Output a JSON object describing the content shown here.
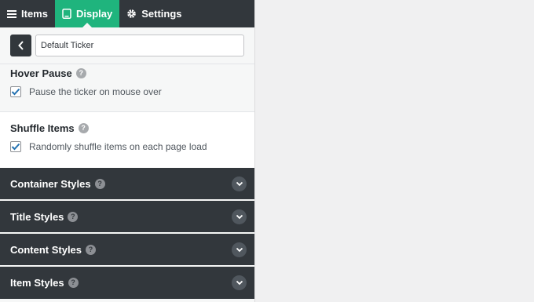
{
  "tabs": [
    {
      "label": "Items",
      "icon": "menu-icon"
    },
    {
      "label": "Display",
      "icon": "tablet-icon"
    },
    {
      "label": "Settings",
      "icon": "gear-icon"
    }
  ],
  "titlebar": {
    "name_value": "Default Ticker"
  },
  "hover_pause": {
    "title": "Hover Pause",
    "help": "?",
    "checkbox_label": "Pause the ticker on mouse over",
    "checked": true
  },
  "shuffle_items": {
    "title": "Shuffle Items",
    "help": "?",
    "checkbox_label": "Randomly shuffle items on each page load",
    "checked": true
  },
  "accordions": [
    {
      "title": "Container Styles",
      "help": "?"
    },
    {
      "title": "Title Styles",
      "help": "?"
    },
    {
      "title": "Content Styles",
      "help": "?"
    },
    {
      "title": "Item Styles",
      "help": "?"
    }
  ],
  "colors": {
    "dark": "#32373c",
    "active_tab": "#1fb47d",
    "check": "#2271b1"
  }
}
